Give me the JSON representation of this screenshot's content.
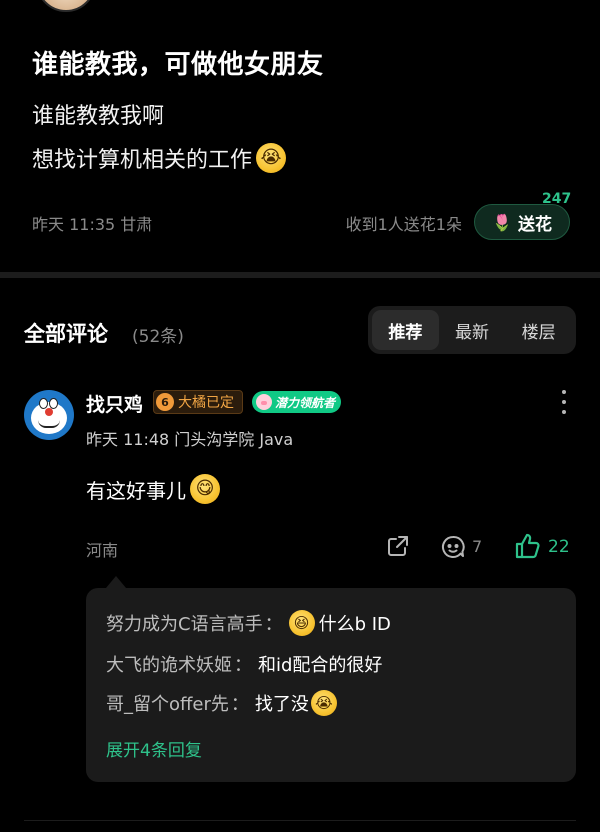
{
  "post": {
    "title": "谁能教我，可做他女朋友",
    "line1": "谁能教教我啊",
    "line2": "想找计算机相关的工作",
    "line2_emoji": "😭",
    "meta": "昨天 11:35 甘肃",
    "flower_text": "收到1人送花1朵",
    "flower_count": "247",
    "flower_button": "送花",
    "flower_icon": "🌷"
  },
  "comments_header": {
    "title": "全部评论",
    "count": "(52条)",
    "sort_tabs": [
      {
        "label": "推荐",
        "active": true
      },
      {
        "label": "最新",
        "active": false
      },
      {
        "label": "楼层",
        "active": false
      }
    ]
  },
  "comment": {
    "author": "找只鸡",
    "level": "6",
    "badge_text": "大橘已定",
    "tag_text": "潜力领航者",
    "meta": "昨天 11:48  门头沟学院 Java",
    "text": "有这好事儿",
    "text_emoji": "😋",
    "location": "河南",
    "reply_count": "7",
    "like_count": "22",
    "replies": [
      {
        "author": "努力成为C语言高手",
        "text": "什么b ID",
        "emoji": "😆"
      },
      {
        "author": "大飞的诡术妖姬",
        "text": "和id配合的很好",
        "emoji": ""
      },
      {
        "author": "哥_留个offer先",
        "text": "找了没",
        "emoji": "😭"
      }
    ],
    "expand_text": "展开4条回复"
  },
  "colors": {
    "background": "#000000",
    "accent_green": "#2ec28b",
    "muted_text": "#8a8a8a",
    "reply_bg": "#1b1b1b",
    "level_orange": "#f1a544"
  }
}
